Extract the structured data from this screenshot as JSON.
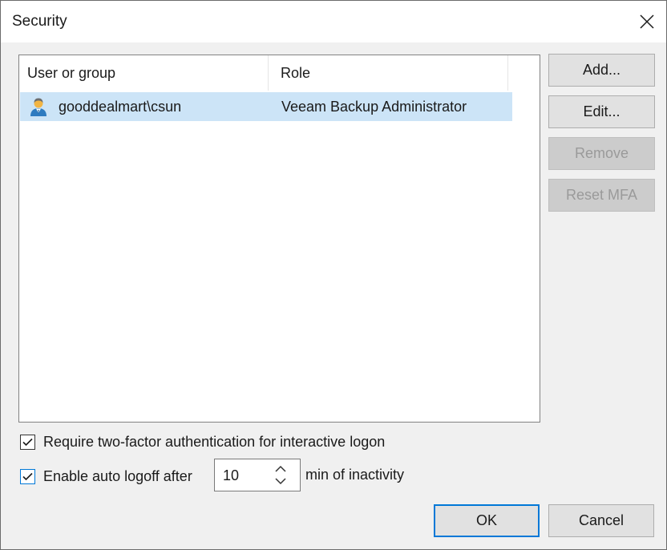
{
  "window": {
    "title": "Security",
    "close_icon": "close-x-icon"
  },
  "list": {
    "columns": [
      "User or group",
      "Role"
    ],
    "rows": [
      {
        "icon": "user-icon",
        "user": "gooddealmart\\csun",
        "role": "Veeam Backup Administrator",
        "selected": true
      }
    ]
  },
  "side_buttons": {
    "add": "Add...",
    "edit": "Edit...",
    "remove": "Remove",
    "reset_mfa": "Reset MFA"
  },
  "options": {
    "mfa": {
      "label": "Require two-factor authentication for interactive logon",
      "checked": true
    },
    "auto_logoff": {
      "label": "Enable auto logoff after",
      "checked": true,
      "value": "10",
      "suffix": "min of inactivity"
    }
  },
  "footer": {
    "ok": "OK",
    "cancel": "Cancel"
  },
  "colors": {
    "selection": "#cce4f7",
    "focus_accent": "#0078d7",
    "dialog_bg": "#f0f0f0"
  }
}
